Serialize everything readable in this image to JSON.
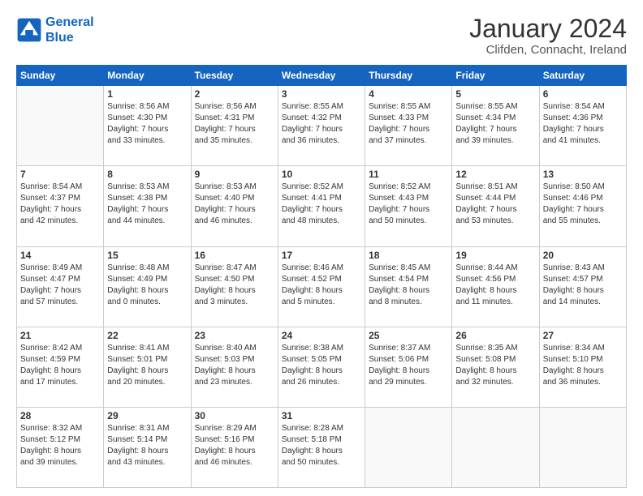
{
  "header": {
    "logo_line1": "General",
    "logo_line2": "Blue",
    "title": "January 2024",
    "subtitle": "Clifden, Connacht, Ireland"
  },
  "calendar": {
    "days_of_week": [
      "Sunday",
      "Monday",
      "Tuesday",
      "Wednesday",
      "Thursday",
      "Friday",
      "Saturday"
    ],
    "weeks": [
      [
        {
          "day": "",
          "info": ""
        },
        {
          "day": "1",
          "info": "Sunrise: 8:56 AM\nSunset: 4:30 PM\nDaylight: 7 hours\nand 33 minutes."
        },
        {
          "day": "2",
          "info": "Sunrise: 8:56 AM\nSunset: 4:31 PM\nDaylight: 7 hours\nand 35 minutes."
        },
        {
          "day": "3",
          "info": "Sunrise: 8:55 AM\nSunset: 4:32 PM\nDaylight: 7 hours\nand 36 minutes."
        },
        {
          "day": "4",
          "info": "Sunrise: 8:55 AM\nSunset: 4:33 PM\nDaylight: 7 hours\nand 37 minutes."
        },
        {
          "day": "5",
          "info": "Sunrise: 8:55 AM\nSunset: 4:34 PM\nDaylight: 7 hours\nand 39 minutes."
        },
        {
          "day": "6",
          "info": "Sunrise: 8:54 AM\nSunset: 4:36 PM\nDaylight: 7 hours\nand 41 minutes."
        }
      ],
      [
        {
          "day": "7",
          "info": "Sunrise: 8:54 AM\nSunset: 4:37 PM\nDaylight: 7 hours\nand 42 minutes."
        },
        {
          "day": "8",
          "info": "Sunrise: 8:53 AM\nSunset: 4:38 PM\nDaylight: 7 hours\nand 44 minutes."
        },
        {
          "day": "9",
          "info": "Sunrise: 8:53 AM\nSunset: 4:40 PM\nDaylight: 7 hours\nand 46 minutes."
        },
        {
          "day": "10",
          "info": "Sunrise: 8:52 AM\nSunset: 4:41 PM\nDaylight: 7 hours\nand 48 minutes."
        },
        {
          "day": "11",
          "info": "Sunrise: 8:52 AM\nSunset: 4:43 PM\nDaylight: 7 hours\nand 50 minutes."
        },
        {
          "day": "12",
          "info": "Sunrise: 8:51 AM\nSunset: 4:44 PM\nDaylight: 7 hours\nand 53 minutes."
        },
        {
          "day": "13",
          "info": "Sunrise: 8:50 AM\nSunset: 4:46 PM\nDaylight: 7 hours\nand 55 minutes."
        }
      ],
      [
        {
          "day": "14",
          "info": "Sunrise: 8:49 AM\nSunset: 4:47 PM\nDaylight: 7 hours\nand 57 minutes."
        },
        {
          "day": "15",
          "info": "Sunrise: 8:48 AM\nSunset: 4:49 PM\nDaylight: 8 hours\nand 0 minutes."
        },
        {
          "day": "16",
          "info": "Sunrise: 8:47 AM\nSunset: 4:50 PM\nDaylight: 8 hours\nand 3 minutes."
        },
        {
          "day": "17",
          "info": "Sunrise: 8:46 AM\nSunset: 4:52 PM\nDaylight: 8 hours\nand 5 minutes."
        },
        {
          "day": "18",
          "info": "Sunrise: 8:45 AM\nSunset: 4:54 PM\nDaylight: 8 hours\nand 8 minutes."
        },
        {
          "day": "19",
          "info": "Sunrise: 8:44 AM\nSunset: 4:56 PM\nDaylight: 8 hours\nand 11 minutes."
        },
        {
          "day": "20",
          "info": "Sunrise: 8:43 AM\nSunset: 4:57 PM\nDaylight: 8 hours\nand 14 minutes."
        }
      ],
      [
        {
          "day": "21",
          "info": "Sunrise: 8:42 AM\nSunset: 4:59 PM\nDaylight: 8 hours\nand 17 minutes."
        },
        {
          "day": "22",
          "info": "Sunrise: 8:41 AM\nSunset: 5:01 PM\nDaylight: 8 hours\nand 20 minutes."
        },
        {
          "day": "23",
          "info": "Sunrise: 8:40 AM\nSunset: 5:03 PM\nDaylight: 8 hours\nand 23 minutes."
        },
        {
          "day": "24",
          "info": "Sunrise: 8:38 AM\nSunset: 5:05 PM\nDaylight: 8 hours\nand 26 minutes."
        },
        {
          "day": "25",
          "info": "Sunrise: 8:37 AM\nSunset: 5:06 PM\nDaylight: 8 hours\nand 29 minutes."
        },
        {
          "day": "26",
          "info": "Sunrise: 8:35 AM\nSunset: 5:08 PM\nDaylight: 8 hours\nand 32 minutes."
        },
        {
          "day": "27",
          "info": "Sunrise: 8:34 AM\nSunset: 5:10 PM\nDaylight: 8 hours\nand 36 minutes."
        }
      ],
      [
        {
          "day": "28",
          "info": "Sunrise: 8:32 AM\nSunset: 5:12 PM\nDaylight: 8 hours\nand 39 minutes."
        },
        {
          "day": "29",
          "info": "Sunrise: 8:31 AM\nSunset: 5:14 PM\nDaylight: 8 hours\nand 43 minutes."
        },
        {
          "day": "30",
          "info": "Sunrise: 8:29 AM\nSunset: 5:16 PM\nDaylight: 8 hours\nand 46 minutes."
        },
        {
          "day": "31",
          "info": "Sunrise: 8:28 AM\nSunset: 5:18 PM\nDaylight: 8 hours\nand 50 minutes."
        },
        {
          "day": "",
          "info": ""
        },
        {
          "day": "",
          "info": ""
        },
        {
          "day": "",
          "info": ""
        }
      ]
    ]
  }
}
